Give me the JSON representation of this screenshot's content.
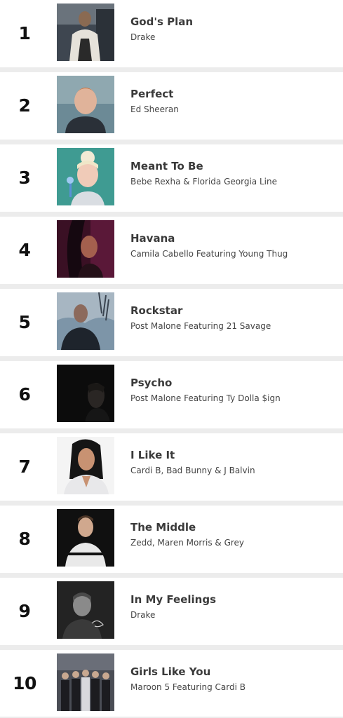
{
  "chart": {
    "entries": [
      {
        "rank": "1",
        "title": "God's Plan",
        "artist": "Drake"
      },
      {
        "rank": "2",
        "title": "Perfect",
        "artist": "Ed Sheeran"
      },
      {
        "rank": "3",
        "title": "Meant To Be",
        "artist": "Bebe Rexha & Florida Georgia Line"
      },
      {
        "rank": "4",
        "title": "Havana",
        "artist": "Camila Cabello Featuring Young Thug"
      },
      {
        "rank": "5",
        "title": "Rockstar",
        "artist": "Post Malone Featuring 21 Savage"
      },
      {
        "rank": "6",
        "title": "Psycho",
        "artist": "Post Malone Featuring Ty Dolla $ign"
      },
      {
        "rank": "7",
        "title": "I Like It",
        "artist": "Cardi B, Bad Bunny & J Balvin"
      },
      {
        "rank": "8",
        "title": "The Middle",
        "artist": "Zedd, Maren Morris & Grey"
      },
      {
        "rank": "9",
        "title": "In My Feelings",
        "artist": "Drake"
      },
      {
        "rank": "10",
        "title": "Girls Like You",
        "artist": "Maroon 5 Featuring Cardi B"
      }
    ]
  }
}
